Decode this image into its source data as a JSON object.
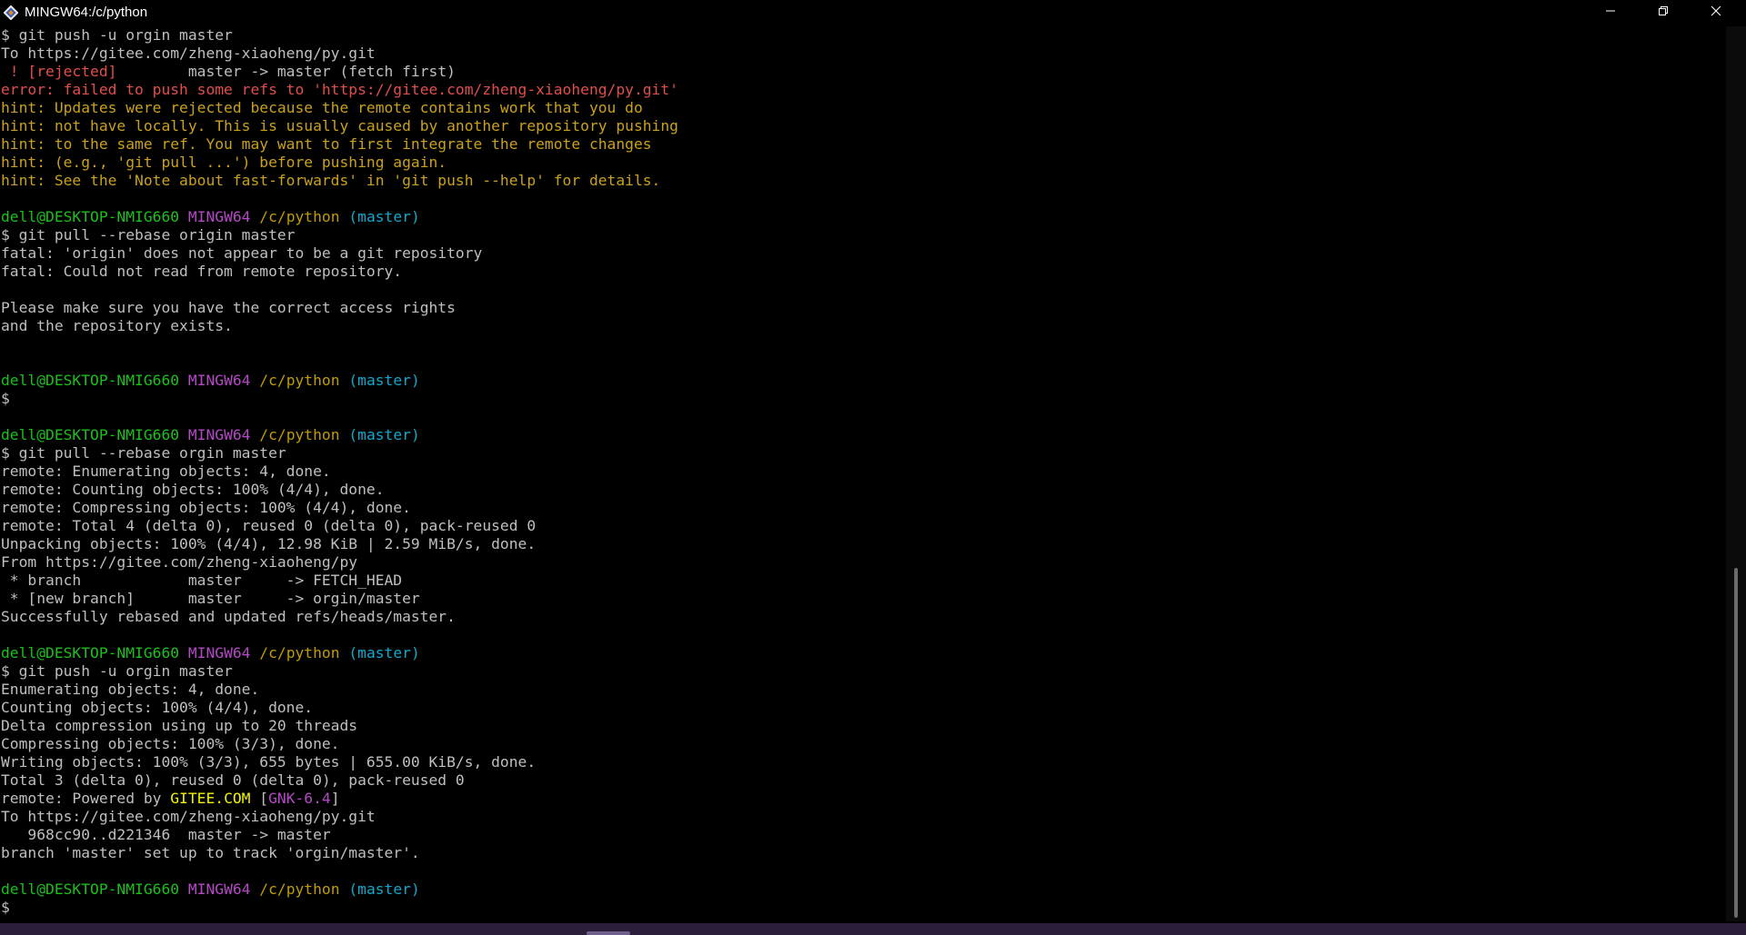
{
  "window": {
    "title": "MINGW64:/c/python",
    "controls": {
      "minimize": "minimize-icon",
      "maximize": "restore-icon",
      "close": "close-icon"
    }
  },
  "colors": {
    "background": "#000000",
    "text": "#bfbfbf",
    "error": "#e24d4d",
    "hint": "#c9a11c",
    "user_host": "#1bbf1b",
    "system": "#b548c6",
    "path": "#c19c00",
    "branch": "#11a8cd",
    "highlight": "#f2f200"
  },
  "terminal": {
    "lines": [
      [
        {
          "t": "$ git push -u orgin master",
          "c": "fg"
        }
      ],
      [
        {
          "t": "To https://gitee.com/zheng-xiaoheng/py.git",
          "c": "fg"
        }
      ],
      [
        {
          "t": " ! [rejected]        ",
          "c": "red"
        },
        {
          "t": "master -> master (fetch first)",
          "c": "fg"
        }
      ],
      [
        {
          "t": "error: failed to push some refs to 'https://gitee.com/zheng-xiaoheng/py.git'",
          "c": "red"
        }
      ],
      [
        {
          "t": "hint: Updates were rejected because the remote contains work that you do",
          "c": "yellow"
        }
      ],
      [
        {
          "t": "hint: not have locally. This is usually caused by another repository pushing",
          "c": "yellow"
        }
      ],
      [
        {
          "t": "hint: to the same ref. You may want to first integrate the remote changes",
          "c": "yellow"
        }
      ],
      [
        {
          "t": "hint: (e.g., 'git pull ...') before pushing again.",
          "c": "yellow"
        }
      ],
      [
        {
          "t": "hint: See the 'Note about fast-forwards' in 'git push --help' for details.",
          "c": "yellow"
        }
      ],
      [],
      [
        {
          "t": "dell@DESKTOP-NMIG660",
          "c": "green"
        },
        {
          "t": " ",
          "c": "fg"
        },
        {
          "t": "MINGW64",
          "c": "magenta"
        },
        {
          "t": " ",
          "c": "fg"
        },
        {
          "t": "/c/python",
          "c": "path"
        },
        {
          "t": " ",
          "c": "fg"
        },
        {
          "t": "(master)",
          "c": "cyan"
        }
      ],
      [
        {
          "t": "$ git pull --rebase origin master",
          "c": "fg"
        }
      ],
      [
        {
          "t": "fatal: 'origin' does not appear to be a git repository",
          "c": "fg"
        }
      ],
      [
        {
          "t": "fatal: Could not read from remote repository.",
          "c": "fg"
        }
      ],
      [],
      [
        {
          "t": "Please make sure you have the correct access rights",
          "c": "fg"
        }
      ],
      [
        {
          "t": "and the repository exists.",
          "c": "fg"
        }
      ],
      [],
      [],
      [
        {
          "t": "dell@DESKTOP-NMIG660",
          "c": "green"
        },
        {
          "t": " ",
          "c": "fg"
        },
        {
          "t": "MINGW64",
          "c": "magenta"
        },
        {
          "t": " ",
          "c": "fg"
        },
        {
          "t": "/c/python",
          "c": "path"
        },
        {
          "t": " ",
          "c": "fg"
        },
        {
          "t": "(master)",
          "c": "cyan"
        }
      ],
      [
        {
          "t": "$",
          "c": "fg"
        }
      ],
      [],
      [
        {
          "t": "dell@DESKTOP-NMIG660",
          "c": "green"
        },
        {
          "t": " ",
          "c": "fg"
        },
        {
          "t": "MINGW64",
          "c": "magenta"
        },
        {
          "t": " ",
          "c": "fg"
        },
        {
          "t": "/c/python",
          "c": "path"
        },
        {
          "t": " ",
          "c": "fg"
        },
        {
          "t": "(master)",
          "c": "cyan"
        }
      ],
      [
        {
          "t": "$ git pull --rebase orgin master",
          "c": "fg"
        }
      ],
      [
        {
          "t": "remote: Enumerating objects: 4, done.",
          "c": "fg"
        }
      ],
      [
        {
          "t": "remote: Counting objects: 100% (4/4), done.",
          "c": "fg"
        }
      ],
      [
        {
          "t": "remote: Compressing objects: 100% (4/4), done.",
          "c": "fg"
        }
      ],
      [
        {
          "t": "remote: Total 4 (delta 0), reused 0 (delta 0), pack-reused 0",
          "c": "fg"
        }
      ],
      [
        {
          "t": "Unpacking objects: 100% (4/4), 12.98 KiB | 2.59 MiB/s, done.",
          "c": "fg"
        }
      ],
      [
        {
          "t": "From https://gitee.com/zheng-xiaoheng/py",
          "c": "fg"
        }
      ],
      [
        {
          "t": " * branch            master     -> FETCH_HEAD",
          "c": "fg"
        }
      ],
      [
        {
          "t": " * [new branch]      master     -> orgin/master",
          "c": "fg"
        }
      ],
      [
        {
          "t": "Successfully rebased and updated refs/heads/master.",
          "c": "fg"
        }
      ],
      [],
      [
        {
          "t": "dell@DESKTOP-NMIG660",
          "c": "green"
        },
        {
          "t": " ",
          "c": "fg"
        },
        {
          "t": "MINGW64",
          "c": "magenta"
        },
        {
          "t": " ",
          "c": "fg"
        },
        {
          "t": "/c/python",
          "c": "path"
        },
        {
          "t": " ",
          "c": "fg"
        },
        {
          "t": "(master)",
          "c": "cyan"
        }
      ],
      [
        {
          "t": "$ git push -u orgin master",
          "c": "fg"
        }
      ],
      [
        {
          "t": "Enumerating objects: 4, done.",
          "c": "fg"
        }
      ],
      [
        {
          "t": "Counting objects: 100% (4/4), done.",
          "c": "fg"
        }
      ],
      [
        {
          "t": "Delta compression using up to 20 threads",
          "c": "fg"
        }
      ],
      [
        {
          "t": "Compressing objects: 100% (3/3), done.",
          "c": "fg"
        }
      ],
      [
        {
          "t": "Writing objects: 100% (3/3), 655 bytes | 655.00 KiB/s, done.",
          "c": "fg"
        }
      ],
      [
        {
          "t": "Total 3 (delta 0), reused 0 (delta 0), pack-reused 0",
          "c": "fg"
        }
      ],
      [
        {
          "t": "remote: Powered by ",
          "c": "fg"
        },
        {
          "t": "GITEE.COM",
          "c": "byellow"
        },
        {
          "t": " [",
          "c": "fg"
        },
        {
          "t": "GNK-6.4",
          "c": "magenta"
        },
        {
          "t": "]",
          "c": "fg"
        }
      ],
      [
        {
          "t": "To https://gitee.com/zheng-xiaoheng/py.git",
          "c": "fg"
        }
      ],
      [
        {
          "t": "   968cc90..d221346  master -> master",
          "c": "fg"
        }
      ],
      [
        {
          "t": "branch 'master' set up to track 'orgin/master'.",
          "c": "fg"
        }
      ],
      [],
      [
        {
          "t": "dell@DESKTOP-NMIG660",
          "c": "green"
        },
        {
          "t": " ",
          "c": "fg"
        },
        {
          "t": "MINGW64",
          "c": "magenta"
        },
        {
          "t": " ",
          "c": "fg"
        },
        {
          "t": "/c/python",
          "c": "path"
        },
        {
          "t": " ",
          "c": "fg"
        },
        {
          "t": "(master)",
          "c": "cyan"
        }
      ],
      [
        {
          "t": "$",
          "c": "fg"
        }
      ]
    ]
  }
}
